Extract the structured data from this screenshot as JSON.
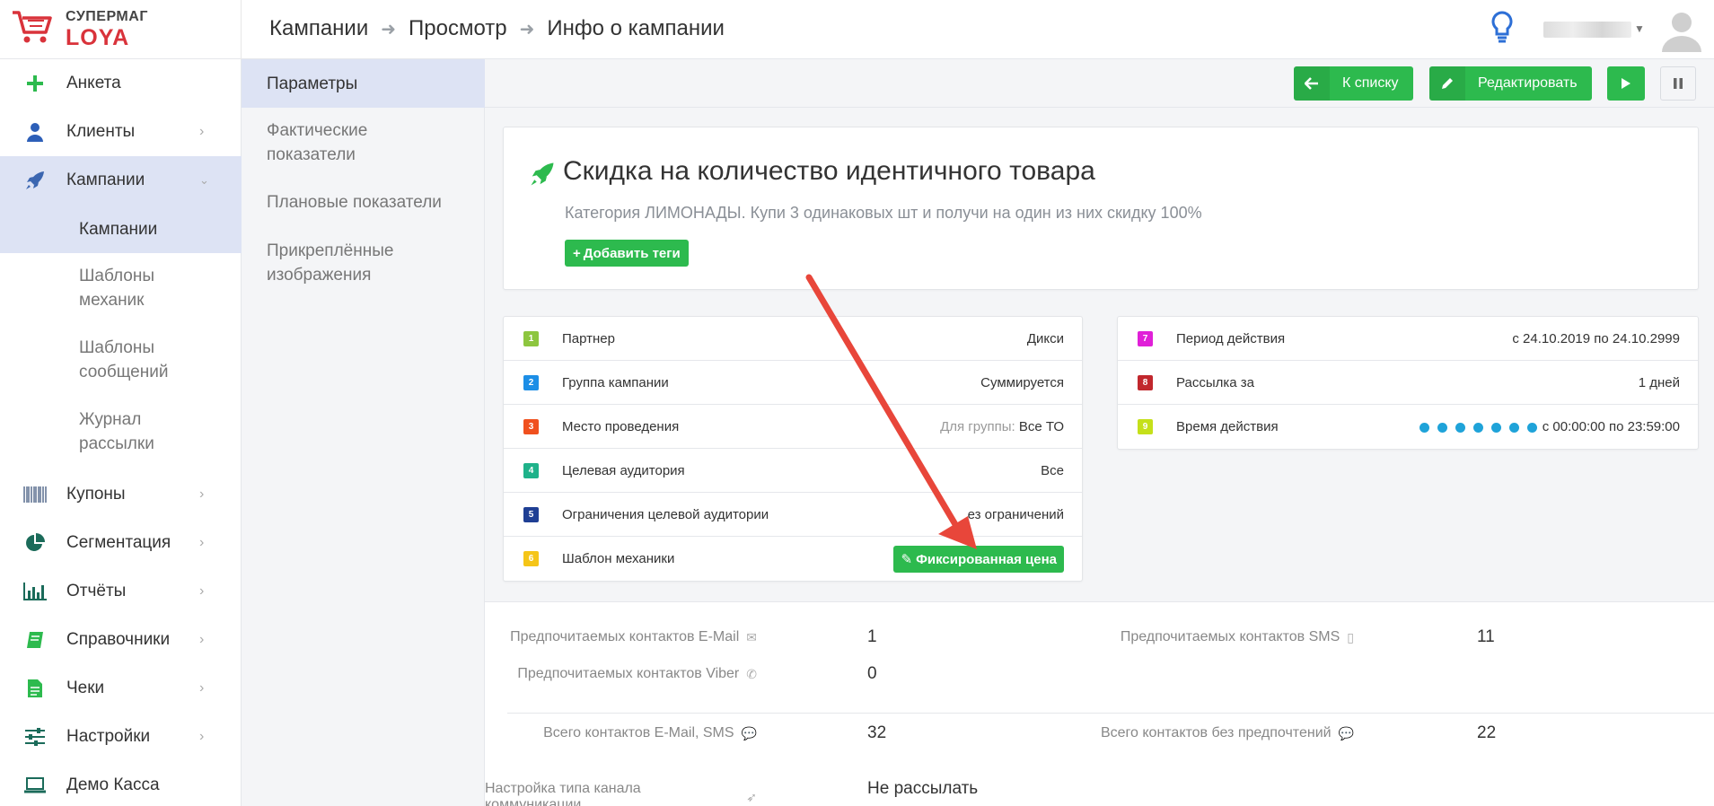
{
  "brand": {
    "line1": "СУПЕРМАГ",
    "line2": "LOYA"
  },
  "breadcrumbs": [
    "Кампании",
    "Просмотр",
    "Инфо о кампании"
  ],
  "sidebar": {
    "items": [
      {
        "label": "Анкета",
        "icon": "plus-icon"
      },
      {
        "label": "Клиенты",
        "icon": "user-icon"
      },
      {
        "label": "Кампании",
        "icon": "rocket-icon"
      },
      {
        "label": "Купоны",
        "icon": "barcode-icon"
      },
      {
        "label": "Сегментация",
        "icon": "pie-chart-icon"
      },
      {
        "label": "Отчёты",
        "icon": "bar-chart-icon"
      },
      {
        "label": "Справочники",
        "icon": "book-icon"
      },
      {
        "label": "Чеки",
        "icon": "receipt-icon"
      },
      {
        "label": "Настройки",
        "icon": "sliders-icon"
      },
      {
        "label": "Демо Касса",
        "icon": "laptop-icon"
      }
    ],
    "sub": [
      {
        "line1": "Кампании",
        "line2": ""
      },
      {
        "line1": "Шаблоны",
        "line2": "механик"
      },
      {
        "line1": "Шаблоны",
        "line2": "сообщений"
      },
      {
        "line1": "Журнал",
        "line2": "рассылки"
      }
    ]
  },
  "subnav": [
    {
      "line1": "Параметры",
      "line2": ""
    },
    {
      "line1": "Фактические",
      "line2": "показатели"
    },
    {
      "line1": "Плановые показатели",
      "line2": ""
    },
    {
      "line1": "Прикреплённые",
      "line2": "изображения"
    }
  ],
  "toolbar": {
    "back": "К списку",
    "edit": "Редактировать"
  },
  "campaign": {
    "title": "Скидка на количество идентичного товара",
    "description": "Категория ЛИМОНАДЫ. Купи 3 одинаковых шт и получи на один из них скидку 100%",
    "add_tags": "Добавить теги"
  },
  "params_left": [
    {
      "num": "1",
      "color": "#8dc63f",
      "label": "Партнер",
      "value": "Дикси"
    },
    {
      "num": "2",
      "color": "#1c8ee6",
      "label": "Группа кампании",
      "value": "Суммируется"
    },
    {
      "num": "3",
      "color": "#f0501e",
      "label": "Место проведения",
      "prefix": "Для группы:",
      "value": "Все ТО"
    },
    {
      "num": "4",
      "color": "#1fb28a",
      "label": "Целевая аудитория",
      "value": "Все"
    },
    {
      "num": "5",
      "color": "#1f3f94",
      "label": "Ограничения целевой аудитории",
      "value": "ез ограничений"
    },
    {
      "num": "6",
      "color": "#f5c518",
      "label": "Шаблон механики",
      "value": "Фиксированная цена"
    }
  ],
  "params_right": [
    {
      "num": "7",
      "color": "#e020d8",
      "label": "Период действия",
      "value": "с 24.10.2019 по 24.10.2999"
    },
    {
      "num": "8",
      "color": "#c1272d",
      "label": "Рассылка за",
      "value": "1 дней"
    },
    {
      "num": "9",
      "color": "#c5e01a",
      "label": "Время действия",
      "value": "с 00:00:00 по 23:59:00"
    }
  ],
  "stats": {
    "email_label": "Предпочитаемых контактов E-Mail",
    "email_value": "1",
    "sms_label": "Предпочитаемых контактов SMS",
    "sms_value": "11",
    "viber_label": "Предпочитаемых контактов Viber",
    "viber_value": "0",
    "total_label": "Всего контактов E-Mail, SMS",
    "total_value": "32",
    "nopref_label": "Всего контактов без предпочтений",
    "nopref_value": "22",
    "channel_label": "Настройка типа канала коммуникации",
    "channel_value": "Не рассылать"
  },
  "colors": {
    "accent_green": "#2dba4e",
    "annotation_arrow": "#e8463a",
    "active_bg": "#dde3f4"
  }
}
